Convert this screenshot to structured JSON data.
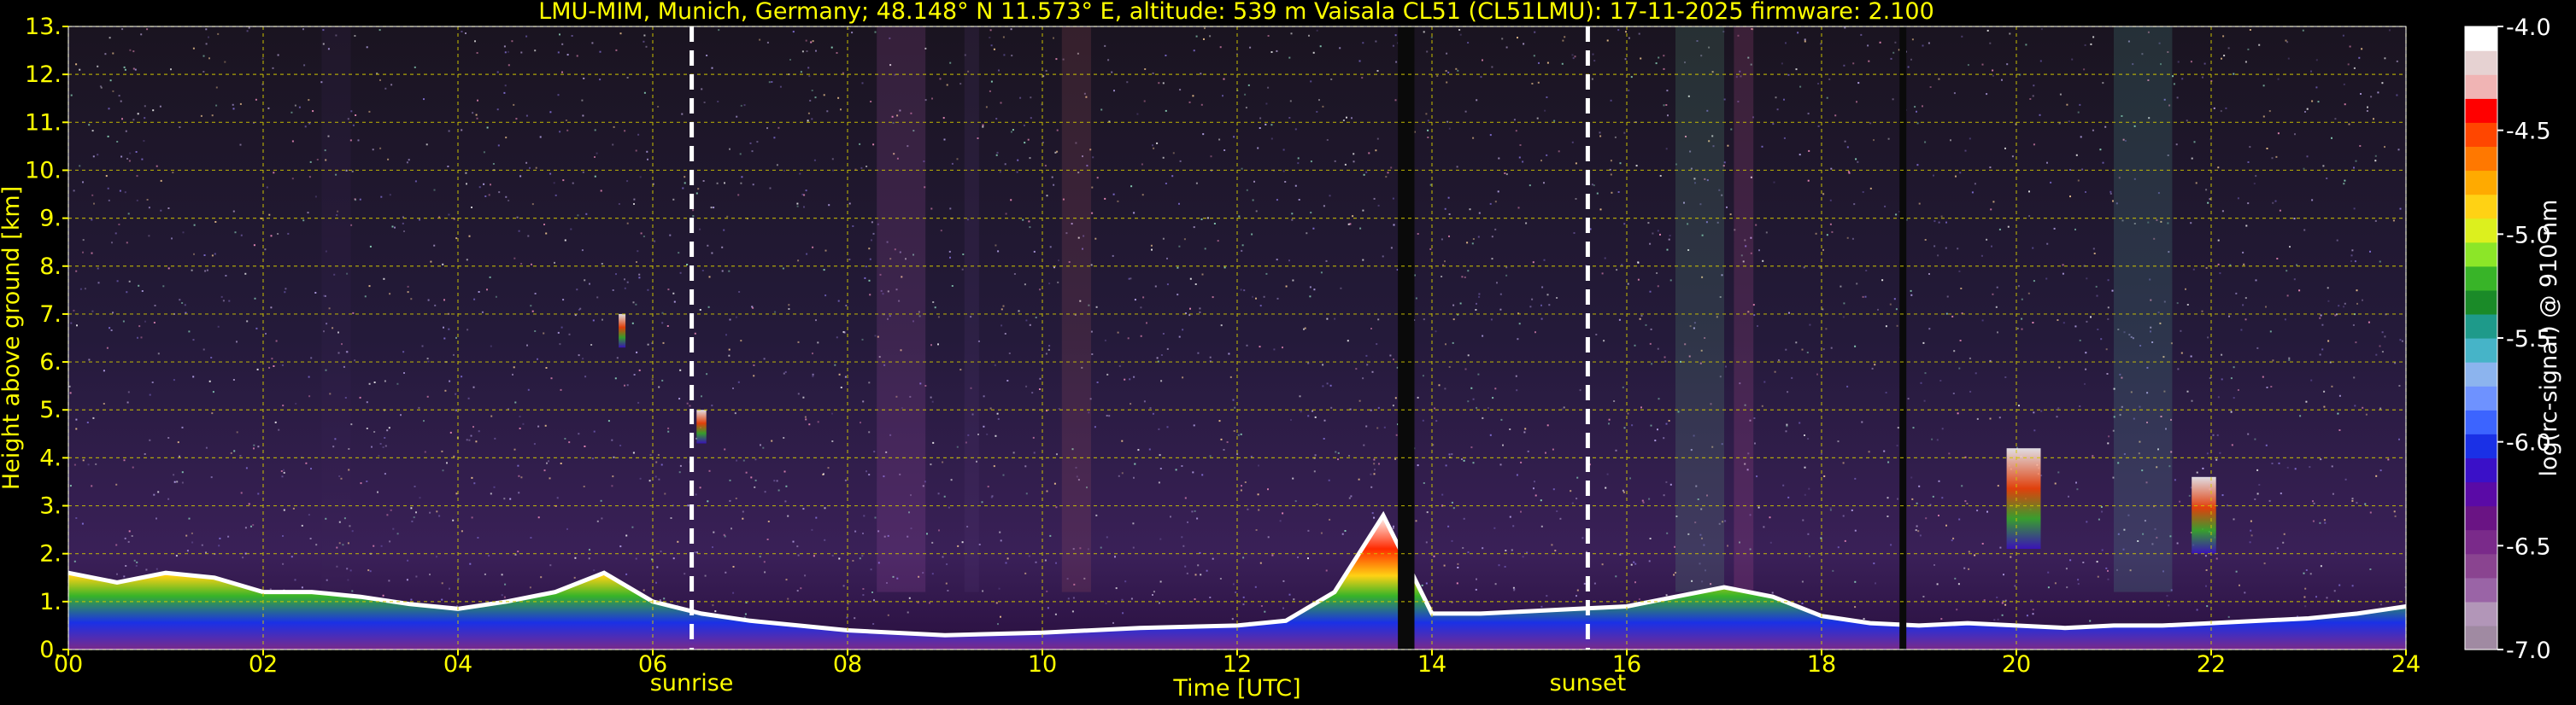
{
  "chart_data": {
    "type": "heatmap",
    "title": "LMU-MIM, Munich, Germany; 48.148° N 11.573° E, altitude: 539 m    Vaisala CL51 (CL51LMU): 17-11-2025    firmware: 2.100",
    "xlabel": "Time [UTC]",
    "ylabel": "Height above ground [km]",
    "xlim": [
      0,
      24
    ],
    "ylim": [
      0,
      13
    ],
    "x_ticks": [
      0,
      2,
      4,
      6,
      8,
      10,
      12,
      14,
      16,
      18,
      20,
      22,
      24
    ],
    "x_tick_labels": [
      "00",
      "02",
      "04",
      "06",
      "08",
      "10",
      "12",
      "14",
      "16",
      "18",
      "20",
      "22",
      "24"
    ],
    "y_ticks": [
      0,
      1,
      2,
      3,
      4,
      5,
      6,
      7,
      8,
      9,
      10,
      11,
      12,
      13
    ],
    "y_tick_labels": [
      "0.",
      "1.",
      "2.",
      "3.",
      "4.",
      "5.",
      "6.",
      "7.",
      "8.",
      "9.",
      "10.",
      "11.",
      "12.",
      "13."
    ],
    "grid": true,
    "markers": [
      {
        "label": "sunrise",
        "time": 6.4
      },
      {
        "label": "sunset",
        "time": 15.6
      }
    ],
    "data_gaps": [
      {
        "start": 13.65,
        "end": 13.82
      },
      {
        "start": 18.8,
        "end": 18.87
      }
    ],
    "boundary_layer_top_km": {
      "time": [
        0,
        0.5,
        1,
        1.5,
        2,
        2.5,
        3,
        3.5,
        4,
        4.5,
        5,
        5.5,
        6,
        6.5,
        7,
        7.5,
        8,
        9,
        10,
        11,
        12,
        12.5,
        13,
        13.5,
        14,
        14.5,
        15,
        15.5,
        16,
        16.5,
        17,
        17.5,
        18,
        18.5,
        19,
        19.5,
        20,
        20.5,
        21,
        21.5,
        22,
        22.5,
        23,
        23.5,
        24
      ],
      "height": [
        1.6,
        1.4,
        1.6,
        1.5,
        1.2,
        1.2,
        1.1,
        0.95,
        0.85,
        1.0,
        1.2,
        1.6,
        1.0,
        0.75,
        0.6,
        0.5,
        0.4,
        0.3,
        0.35,
        0.45,
        0.5,
        0.6,
        1.2,
        2.8,
        0.75,
        0.75,
        0.8,
        0.85,
        0.9,
        1.1,
        1.3,
        1.1,
        0.7,
        0.55,
        0.5,
        0.55,
        0.5,
        0.45,
        0.5,
        0.5,
        0.55,
        0.6,
        0.65,
        0.75,
        0.9
      ]
    },
    "aerosol_layers": [
      {
        "time_start": 19.9,
        "time_end": 20.25,
        "bottom_km": 2.1,
        "top_km": 4.2
      },
      {
        "time_start": 21.8,
        "time_end": 22.05,
        "bottom_km": 2.0,
        "top_km": 3.6
      },
      {
        "time_start": 6.45,
        "time_end": 6.55,
        "bottom_km": 4.3,
        "top_km": 5.0
      },
      {
        "time_start": 5.65,
        "time_end": 5.72,
        "bottom_km": 6.3,
        "top_km": 7.0
      }
    ],
    "colorbar": {
      "label": "log(rc-signal) @ 910 nm",
      "min": -7.0,
      "max": -4.0,
      "ticks": [
        -7.0,
        -6.5,
        -6.0,
        -5.5,
        -5.0,
        -4.5,
        -4.0
      ],
      "tick_labels": [
        "-7.0",
        "-6.5",
        "-6.0",
        "-5.5",
        "-5.0",
        "-4.5",
        "-4.0"
      ],
      "colors": [
        "#a08aa2",
        "#b296b8",
        "#9a64a6",
        "#8a4490",
        "#7a2a8a",
        "#6a1484",
        "#5a0aa6",
        "#3a10c8",
        "#1a30e6",
        "#3c64ff",
        "#6e92ff",
        "#8cb4ee",
        "#46b4c8",
        "#1e9a8a",
        "#1a8a28",
        "#38b428",
        "#8ce628",
        "#dcf01e",
        "#ffd214",
        "#ffaa00",
        "#ff7800",
        "#ff4600",
        "#ff0000",
        "#f0b4b4",
        "#e6d2d2",
        "#ffffff"
      ]
    }
  }
}
